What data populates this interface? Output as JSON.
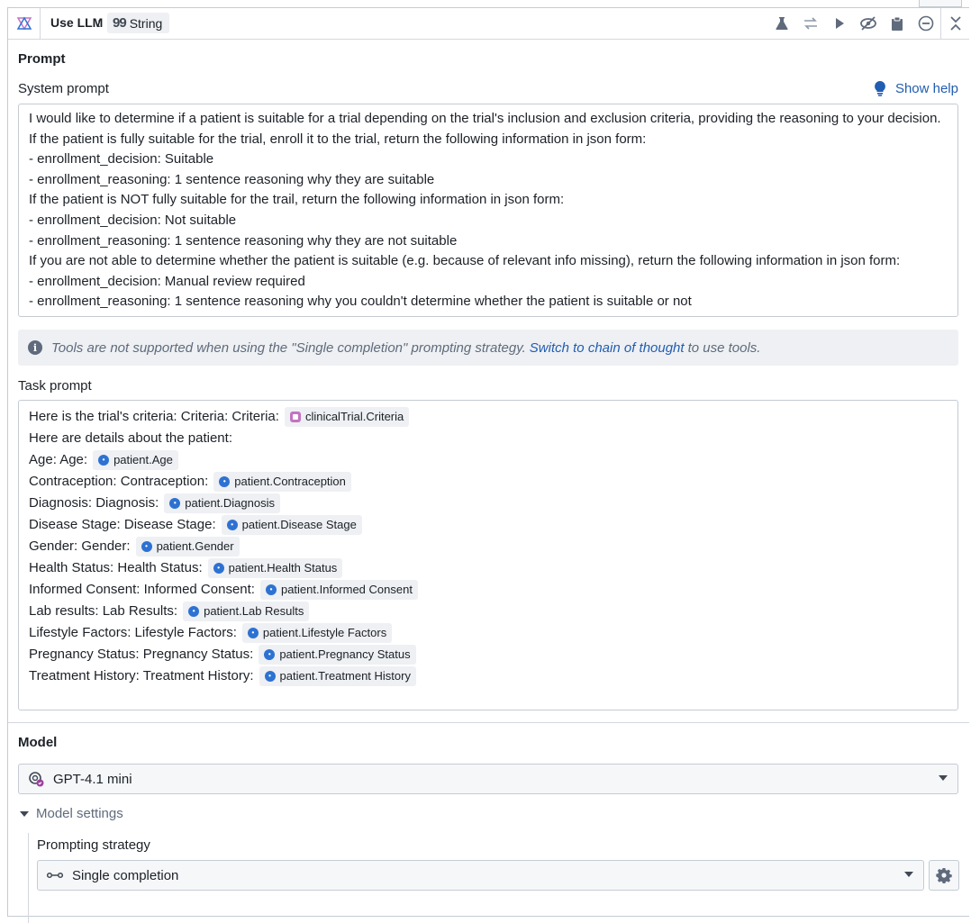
{
  "header": {
    "title": "Use LLM",
    "colon": ":",
    "type_label": "String",
    "type_icon": "quote-icon",
    "icons": [
      "flask-icon",
      "swap-icon",
      "play-icon",
      "eye-off-icon",
      "clipboard-icon",
      "minus-circle-icon",
      "collapse-icon"
    ]
  },
  "prompt": {
    "section_title": "Prompt",
    "system_label": "System prompt",
    "show_help": "Show help",
    "system_lines": [
      "I would like to determine if a patient is suitable for a trial depending on the trial's inclusion and exclusion criteria, providing the reasoning to your decision.",
      "If the patient is fully suitable for the trial, enroll it to the trial, return the following information in json form:",
      "- enrollment_decision: Suitable",
      "- enrollment_reasoning: 1 sentence reasoning why they are suitable",
      "If the patient is NOT fully suitable for the trail, return the following information in json form:",
      "- enrollment_decision: Not suitable",
      "- enrollment_reasoning: 1 sentence reasoning why they are not suitable",
      "If you are not able to determine whether the patient is suitable (e.g. because of relevant info missing), return the following information in json form:",
      "- enrollment_decision: Manual review required",
      "- enrollment_reasoning: 1 sentence reasoning why you couldn't determine whether the patient is suitable or not"
    ],
    "callout": {
      "before": "Tools are not supported when using the \"Single completion\" prompting strategy.",
      "link": "Switch to chain of thought",
      "after": "to use tools."
    },
    "task_label": "Task prompt",
    "task_lines": [
      {
        "text": "Here is the trial's criteria: Criteria: Criteria:",
        "chip": "clinicalTrial.Criteria",
        "chip_kind": "object"
      },
      {
        "text": "Here are details about the patient:",
        "chip": "",
        "chip_kind": ""
      },
      {
        "text": "Age:  Age:",
        "chip": "patient.Age",
        "chip_kind": "property"
      },
      {
        "text": "Contraception:  Contraception:",
        "chip": "patient.Contraception",
        "chip_kind": "property"
      },
      {
        "text": "Diagnosis:  Diagnosis:",
        "chip": "patient.Diagnosis",
        "chip_kind": "property"
      },
      {
        "text": "Disease Stage:  Disease Stage:",
        "chip": "patient.Disease Stage",
        "chip_kind": "property"
      },
      {
        "text": "Gender:  Gender:",
        "chip": "patient.Gender",
        "chip_kind": "property"
      },
      {
        "text": "Health Status:  Health Status:",
        "chip": "patient.Health Status",
        "chip_kind": "property"
      },
      {
        "text": "Informed Consent:  Informed Consent:",
        "chip": "patient.Informed Consent",
        "chip_kind": "property"
      },
      {
        "text": "Lab results:  Lab Results:",
        "chip": "patient.Lab Results",
        "chip_kind": "property"
      },
      {
        "text": "Lifestyle Factors:  Lifestyle Factors:",
        "chip": "patient.Lifestyle Factors",
        "chip_kind": "property"
      },
      {
        "text": "Pregnancy Status:  Pregnancy Status:",
        "chip": "patient.Pregnancy Status",
        "chip_kind": "property"
      },
      {
        "text": "Treatment History:  Treatment History:",
        "chip": "patient.Treatment History",
        "chip_kind": "property"
      }
    ]
  },
  "model": {
    "section_title": "Model",
    "selected": "GPT-4.1 mini",
    "settings_label": "Model settings",
    "strategy_label": "Prompting strategy",
    "strategy_value": "Single completion"
  },
  "colors": {
    "accent": "#215db0",
    "chip_property": "#2d72d2",
    "chip_object": "#c274c2",
    "border": "#c5cbd3"
  }
}
